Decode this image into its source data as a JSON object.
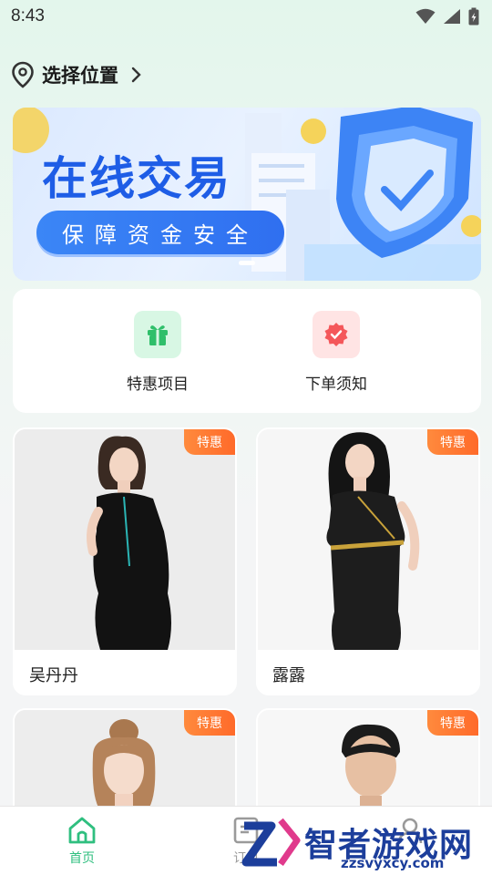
{
  "status_bar": {
    "time": "8:43",
    "icons": [
      "wifi-icon",
      "signal-icon",
      "battery-icon"
    ]
  },
  "location": {
    "label": "选择位置",
    "icon": "location-pin-icon",
    "arrow": "chevron-right-icon"
  },
  "banner": {
    "title": "在线交易",
    "subtitle": "保障资金安全",
    "colors": {
      "title": "#1e5de6",
      "pill": "#2f6ff0"
    }
  },
  "quick_actions": [
    {
      "label": "特惠项目",
      "icon": "gift-icon",
      "bg": "#d8f7e4",
      "fg": "#2fbf6a"
    },
    {
      "label": "下单须知",
      "icon": "badge-check-icon",
      "bg": "#ffe4e4",
      "fg": "#f4575a"
    }
  ],
  "products": [
    {
      "name": "吴丹丹",
      "badge": "特惠"
    },
    {
      "name": "露露",
      "badge": "特惠"
    },
    {
      "name": "",
      "badge": "特惠"
    },
    {
      "name": "",
      "badge": "特惠"
    }
  ],
  "tabs": [
    {
      "label": "首页",
      "icon": "home-icon",
      "active": true
    },
    {
      "label": "订单",
      "icon": "order-icon",
      "active": false
    },
    {
      "label": "",
      "icon": "user-icon",
      "active": false
    }
  ],
  "watermark": {
    "text": "智者游戏网",
    "url": "zzsvyxcy.com"
  },
  "colors": {
    "accent": "#2fbf7f",
    "badge": "#ff7a33"
  }
}
